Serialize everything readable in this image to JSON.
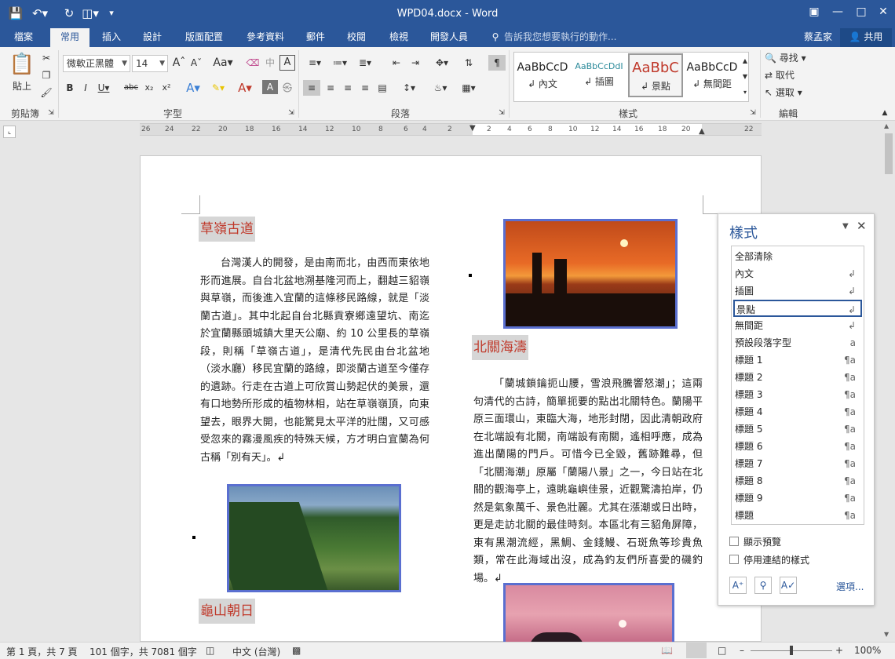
{
  "window": {
    "title": "WPD04.docx - Word",
    "user": "蔡孟家",
    "share": "共用"
  },
  "tabs": [
    "檔案",
    "常用",
    "插入",
    "設計",
    "版面配置",
    "參考資料",
    "郵件",
    "校閱",
    "檢視",
    "開發人員"
  ],
  "tell_me": "告訴我您想要執行的動作...",
  "ribbon": {
    "clipboard": {
      "label": "剪貼簿",
      "paste": "貼上"
    },
    "font": {
      "label": "字型",
      "name": "微軟正黑體",
      "size": "14"
    },
    "paragraph": {
      "label": "段落"
    },
    "styles": {
      "label": "樣式",
      "cards": [
        {
          "sample": "AaBbCcD",
          "name": "↲ 內文",
          "color": "#222222"
        },
        {
          "sample": "AaBbCcDdI",
          "name": "↲ 插圖",
          "color": "#2b8a9a"
        },
        {
          "sample": "AaBbC",
          "name": "↲ 景點",
          "color": "#c0392b"
        },
        {
          "sample": "AaBbCcD",
          "name": "↲ 無間距",
          "color": "#222222"
        }
      ]
    },
    "editing": {
      "label": "編輯",
      "find": "尋找",
      "replace": "取代",
      "select": "選取"
    }
  },
  "ruler": [
    "26",
    "24",
    "22",
    "20",
    "18",
    "16",
    "14",
    "12",
    "10",
    "8",
    "6",
    "4",
    "2",
    "2",
    "4",
    "6",
    "8",
    "10",
    "12",
    "14",
    "16",
    "18",
    "20",
    "22"
  ],
  "document": {
    "h1": "草嶺古道",
    "p1": "台灣漢人的開發，是由南而北，由西而東依地形而進展。自台北盆地溯基隆河而上，翻越三貂嶺與草嶺，而後進入宜蘭的這條移民路線，就是「淡蘭古道」。其中北起自台北縣貢寮鄉遠望坑、南迄於宜蘭縣頭城鎮大里天公廟、約 10 公里長的草嶺段，則稱「草嶺古道」，是清代先民由台北盆地（淡水廳）移民宜蘭的路線，即淡蘭古道至今僅存的遺跡。行走在古道上可欣賞山勢起伏的美景，還有口地勢所形成的植物林相，站在草嶺嶺頂，向東望去，眼界大開，也能驚見太平洋的壯闊，又可感受忽來的霧漫風疾的特殊天候，方才明白宜蘭為何古稱「別有天」。↲",
    "h2": "北關海濤",
    "p2": "「蘭城鎖鑰扼山腰，雪浪飛騰響怒潮」；這兩句清代的古詩，簡單扼要的點出北關特色。蘭陽平原三面環山，東臨大海，地形封閉，因此清朝政府在北端設有北關，南端設有南關，遙相呼應，成為進出蘭陽的門戶。可惜今已全毀，舊跡難尋，但「北關海潮」原屬「蘭陽八景」之一，今日站在北關的觀海亭上，遠眺龜嶼佳景，近觀驚濤拍岸，仍然是氣象萬千、景色壯麗。尤其在漲潮或日出時，更是走訪北關的最佳時刻。本區北有三貂角屏障，東有黑潮流經，黑鯛、金錢鰻、石斑魚等珍貴魚類，常在此海域出沒，成為釣友們所喜愛的磯釣場。↲",
    "h3": "龜山朝日"
  },
  "pane": {
    "title": "樣式",
    "items": [
      {
        "name": "全部清除",
        "mark": ""
      },
      {
        "name": "內文",
        "mark": "↲"
      },
      {
        "name": "插圖",
        "mark": "↲"
      },
      {
        "name": "景點",
        "mark": "↲"
      },
      {
        "name": "無間距",
        "mark": "↲"
      },
      {
        "name": "預設段落字型",
        "mark": "a"
      },
      {
        "name": "標題 1",
        "mark": "¶a"
      },
      {
        "name": "標題 2",
        "mark": "¶a"
      },
      {
        "name": "標題 3",
        "mark": "¶a"
      },
      {
        "name": "標題 4",
        "mark": "¶a"
      },
      {
        "name": "標題 5",
        "mark": "¶a"
      },
      {
        "name": "標題 6",
        "mark": "¶a"
      },
      {
        "name": "標題 7",
        "mark": "¶a"
      },
      {
        "name": "標題 8",
        "mark": "¶a"
      },
      {
        "name": "標題 9",
        "mark": "¶a"
      },
      {
        "name": "標題",
        "mark": "¶a"
      }
    ],
    "selected": "景點",
    "show_preview": "顯示預覽",
    "disable_linked": "停用連結的樣式",
    "options": "選項..."
  },
  "status": {
    "page": "第 1 頁，共 7 頁",
    "words": "101 個字，共 7081 個字",
    "lang": "中文 (台灣)",
    "zoom": "100%"
  }
}
